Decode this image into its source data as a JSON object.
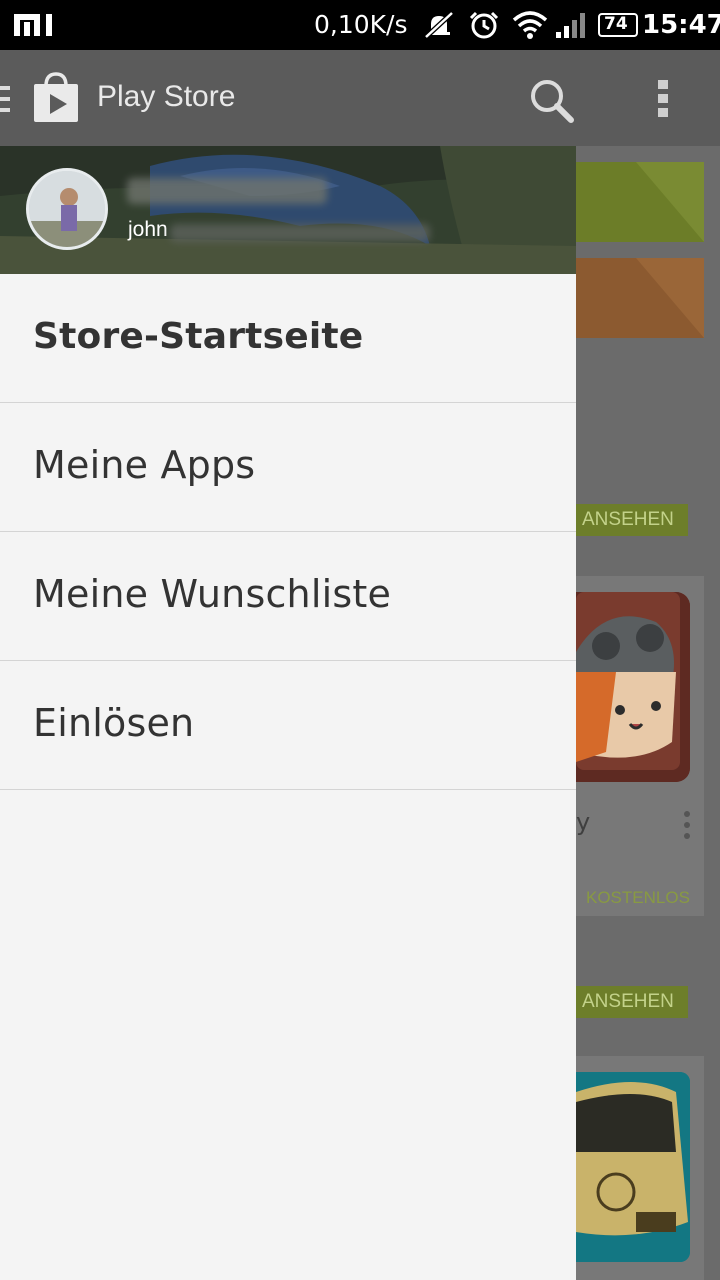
{
  "status_bar": {
    "carrier_logo": "MI",
    "net_speed": "0,10K/s",
    "battery": "74",
    "time": "15:47",
    "icons": [
      "mute-vibrate-icon",
      "alarm-icon",
      "wifi-icon",
      "signal-icon",
      "battery-icon"
    ]
  },
  "action_bar": {
    "title": "Play Store",
    "icons": [
      "menu-icon",
      "play-store-logo-icon",
      "search-icon",
      "overflow-menu-icon"
    ]
  },
  "drawer": {
    "account": {
      "email_visible": "john"
    },
    "items": [
      {
        "label": "Store-Startseite",
        "selected": true
      },
      {
        "label": "Meine Apps",
        "selected": false
      },
      {
        "label": "Meine Wunschliste",
        "selected": false
      },
      {
        "label": "Einlösen",
        "selected": false
      }
    ]
  },
  "background": {
    "view_button_1": "ANSEHEN",
    "app_title_fragment": "y",
    "price_label": "KOSTENLOS",
    "view_button_2": "ANSEHEN"
  },
  "colors": {
    "status_bar": "#000000",
    "action_bar_dimmed": "#5b5b5b",
    "drawer_bg": "#f4f4f4",
    "accent_green": "#8bb629"
  }
}
